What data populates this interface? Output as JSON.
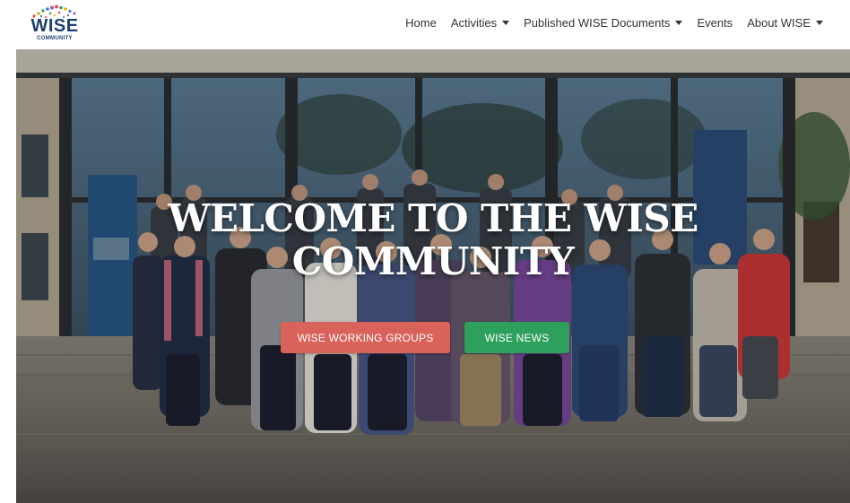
{
  "logo": {
    "word": "WISE",
    "sub": "COMMUNITY"
  },
  "nav": {
    "items": [
      {
        "label": "Home",
        "dropdown": false
      },
      {
        "label": "Activities",
        "dropdown": true
      },
      {
        "label": "Published WISE Documents",
        "dropdown": true
      },
      {
        "label": "Events",
        "dropdown": false
      },
      {
        "label": "About WISE",
        "dropdown": true
      }
    ]
  },
  "hero": {
    "title_line1": "WELCOME TO THE WISE",
    "title_line2": "COMMUNITY",
    "buttons": [
      {
        "label": "WISE WORKING GROUPS",
        "color": "#d9625a"
      },
      {
        "label": "WISE NEWS",
        "color": "#2ea05e"
      }
    ]
  },
  "colors": {
    "brand": "#1d3e72",
    "nav_text": "#333333"
  }
}
